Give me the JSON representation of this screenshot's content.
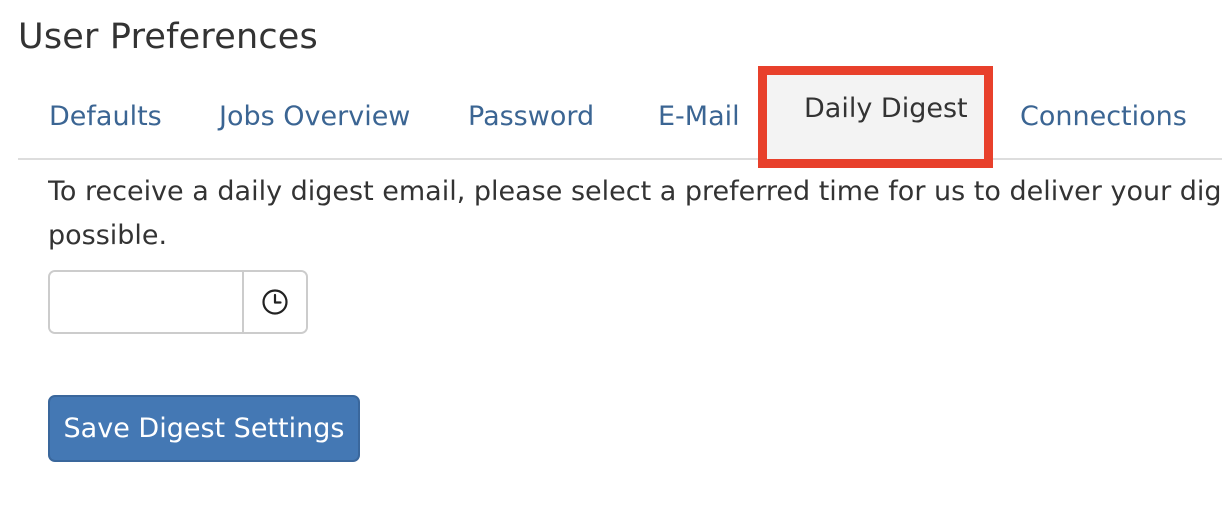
{
  "page_title": "User Preferences",
  "tabs": [
    {
      "label": "Defaults",
      "active": false
    },
    {
      "label": "Jobs Overview",
      "active": false
    },
    {
      "label": "Password",
      "active": false
    },
    {
      "label": "E-Mail",
      "active": false
    },
    {
      "label": "Daily Digest",
      "active": true
    },
    {
      "label": "Connections",
      "active": false
    }
  ],
  "digest": {
    "description_line1": "To receive a daily digest email, please select a preferred time for us to deliver your digest. T",
    "description_line2": "possible.",
    "time_value": "",
    "time_placeholder": "",
    "clock_icon": "clock-icon",
    "save_label": "Save Digest Settings"
  },
  "colors": {
    "tab_link": "#3b6593",
    "highlight_border": "#e8402b",
    "primary_button": "#4478b4"
  }
}
